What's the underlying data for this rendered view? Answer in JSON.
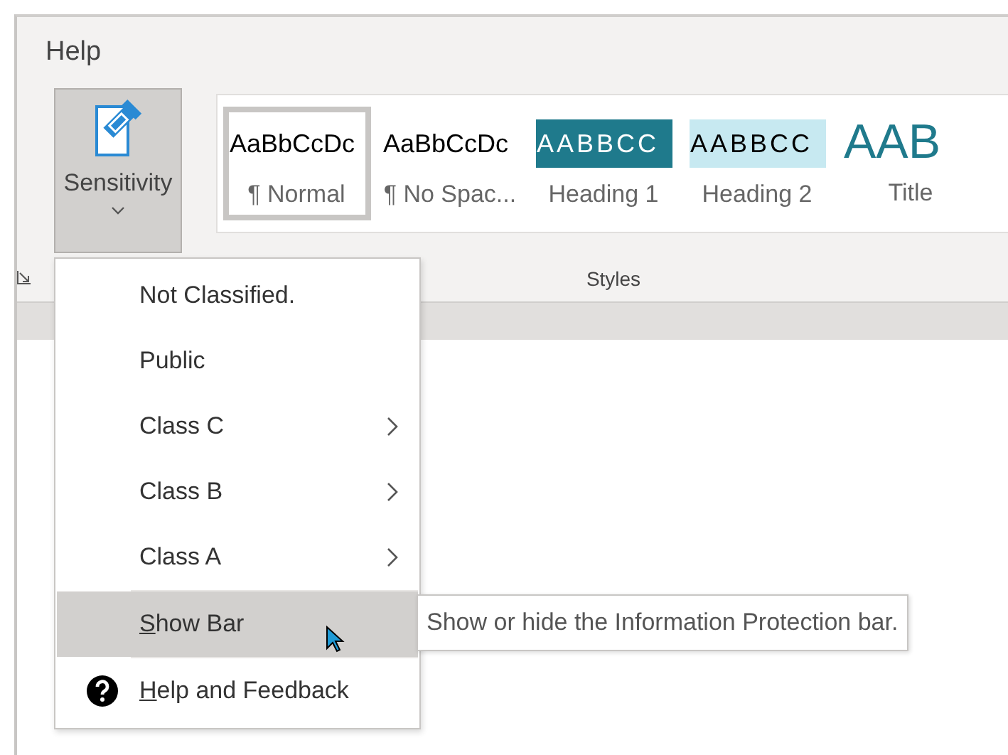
{
  "ribbon": {
    "tab": "Help",
    "sensitivity_button": {
      "label": "Sensitivity",
      "pressed": true
    },
    "styles": {
      "label": "Styles",
      "items": [
        {
          "kind": "normal",
          "preview": "AaBbCcDc",
          "name": "¶ Normal",
          "selected": true
        },
        {
          "kind": "plain",
          "preview": "AaBbCcDc",
          "name": "¶ No Spac...",
          "selected": false
        },
        {
          "kind": "heading1",
          "preview": "AABBCC",
          "name": "Heading 1",
          "selected": false
        },
        {
          "kind": "heading2",
          "preview": "AABBCC",
          "name": "Heading 2",
          "selected": false
        },
        {
          "kind": "title",
          "preview": "AAB",
          "name": "Title",
          "selected": false
        }
      ]
    }
  },
  "menu": {
    "items": [
      {
        "label": "Not Classified.",
        "submenu": false,
        "highlighted": false
      },
      {
        "label": "Public",
        "submenu": false,
        "highlighted": false
      },
      {
        "label": "Class C",
        "submenu": true,
        "highlighted": false
      },
      {
        "label": "Class B",
        "submenu": true,
        "highlighted": false
      },
      {
        "label": "Class A",
        "submenu": true,
        "highlighted": false
      },
      {
        "label": "Show Bar",
        "submenu": false,
        "highlighted": true,
        "underline_first": true
      },
      {
        "label": "Help and Feedback",
        "submenu": false,
        "highlighted": false,
        "underline_first": true,
        "kind": "help"
      }
    ]
  },
  "tooltip": "Show or hide the Information Protection bar."
}
